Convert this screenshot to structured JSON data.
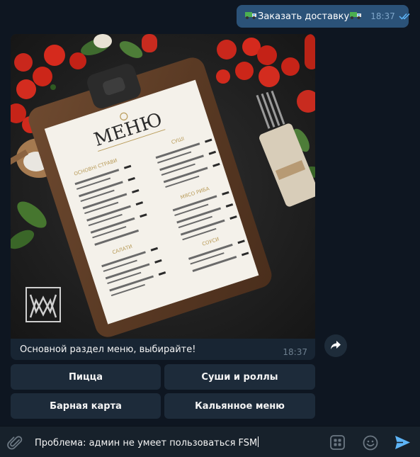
{
  "outgoing": {
    "text": "Заказать доставку",
    "time": "18:37",
    "icon": "truck-icon",
    "status": "read"
  },
  "incoming": {
    "photo": {
      "menu_title": "МЕНЮ",
      "sections": [
        "ОСНОВНІ СТРАВИ",
        "СУШІ",
        "МЯСО РИБА",
        "САЛАТИ",
        "СОУСИ"
      ],
      "logo": "WM"
    },
    "caption": "Основной раздел меню, выбирайте!",
    "time": "18:37"
  },
  "keyboard": {
    "pizza": "Пицца",
    "sushi": "Суши и роллы",
    "bar": "Барная карта",
    "hookah": "Кальянное меню"
  },
  "composer": {
    "text": "Проблема: админ не умеет пользоваться FSM"
  },
  "colors": {
    "background": "#0e1621",
    "outgoing_bubble": "#2b5278",
    "incoming_bubble": "#182533",
    "accent": "#5eb5f7"
  }
}
